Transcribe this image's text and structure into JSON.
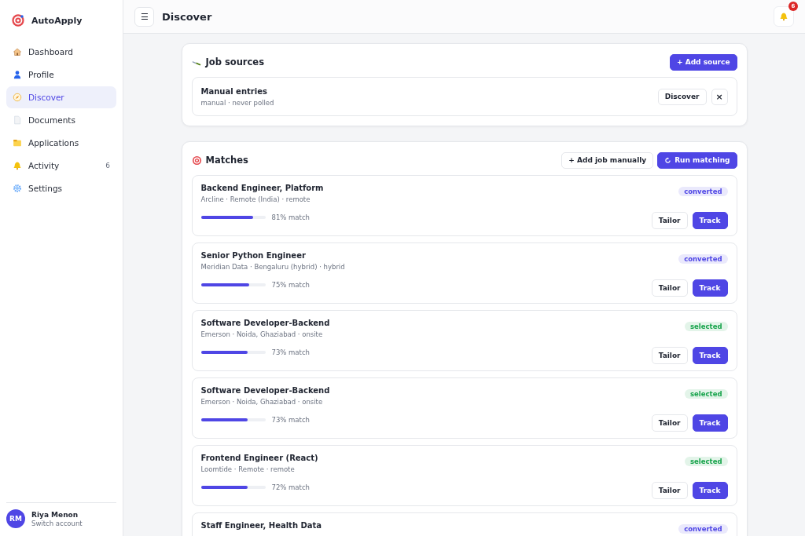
{
  "app": {
    "name": "AutoApply"
  },
  "sidebar": {
    "items": [
      {
        "label": "Dashboard",
        "selected": false
      },
      {
        "label": "Profile",
        "selected": false
      },
      {
        "label": "Discover",
        "selected": true
      },
      {
        "label": "Documents",
        "selected": false
      },
      {
        "label": "Applications",
        "selected": false
      },
      {
        "label": "Activity",
        "selected": false,
        "count": "6"
      },
      {
        "label": "Settings",
        "selected": false
      }
    ]
  },
  "user": {
    "initials": "RM",
    "name": "Riya Menon",
    "action": "Switch account"
  },
  "header": {
    "menu_glyph": "☰",
    "title": "Discover",
    "notification_count": "6"
  },
  "job_sources": {
    "title": "Job sources",
    "add_button": "+ Add source",
    "sources": [
      {
        "name": "Manual entries",
        "meta": "manual · never polled",
        "discover_button": "Discover",
        "remove_glyph": "×"
      }
    ]
  },
  "matches": {
    "title": "Matches",
    "add_button": "+ Add job manually",
    "run_button": "Run matching",
    "items": [
      {
        "title": "Backend Engineer, Platform",
        "meta": "Arcline · Remote (India) · remote",
        "level": 0.81,
        "score": "81% match",
        "status": "converted",
        "color": "#4f46e5",
        "tailor": "Tailor",
        "track": "Track"
      },
      {
        "title": "Senior Python Engineer",
        "meta": "Meridian Data · Bengaluru (hybrid) · hybrid",
        "level": 0.75,
        "score": "75% match",
        "status": "converted",
        "color": "#4f46e5",
        "tailor": "Tailor",
        "track": "Track"
      },
      {
        "title": "Software Developer-Backend",
        "meta": "Emerson · Noida, Ghaziabad · onsite",
        "level": 0.73,
        "score": "73% match",
        "status": "selected",
        "color": "#16a34a",
        "tailor": "Tailor",
        "track": "Track"
      },
      {
        "title": "Software Developer-Backend",
        "meta": "Emerson · Noida, Ghaziabad · onsite",
        "level": 0.73,
        "score": "73% match",
        "status": "selected",
        "color": "#16a34a",
        "tailor": "Tailor",
        "track": "Track"
      },
      {
        "title": "Frontend Engineer (React)",
        "meta": "Loomtide · Remote · remote",
        "level": 0.72,
        "score": "72% match",
        "status": "selected",
        "color": "#16a34a",
        "tailor": "Tailor",
        "track": "Track"
      },
      {
        "title": "Staff Engineer, Health Data",
        "status": "converted",
        "color": "#4f46e5"
      }
    ]
  }
}
